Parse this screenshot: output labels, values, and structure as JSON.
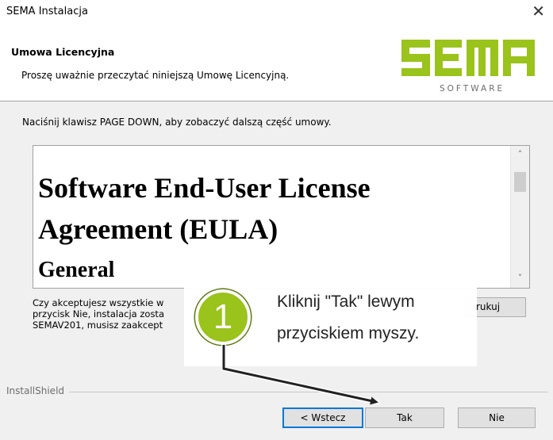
{
  "window": {
    "title": "SEMA Instalacja",
    "close_glyph": "✕"
  },
  "header": {
    "title": "Umowa Licencyjna",
    "subtitle": "Proszę uważnie przeczytać niniejszą Umowę Licencyjną.",
    "logo": {
      "wordmark": "SEMA",
      "subtext": "SOFTWARE",
      "color": "#9ac31c"
    }
  },
  "instruction": "Naciśnij klawisz PAGE DOWN, aby zobaczyć dalszą część umowy.",
  "eula": {
    "heading_line1": "Software End-User License",
    "heading_line2": "Agreement (EULA)",
    "section": "General"
  },
  "question": {
    "line1": "Czy akceptujesz wszystkie w",
    "line2": "przycisk Nie, instalacja zosta",
    "line3": "SEMAV201, musisz zaakcept"
  },
  "buttons": {
    "print_fragment": "rukuj",
    "back": "< Wstecz",
    "yes": "Tak",
    "no": "Nie"
  },
  "installshield": "InstallShield",
  "callout": {
    "step_number": "1",
    "line1": "Kliknij \"Tak\" lewym",
    "line2": "przyciskiem myszy.",
    "badge_color": "#9ac31c"
  }
}
